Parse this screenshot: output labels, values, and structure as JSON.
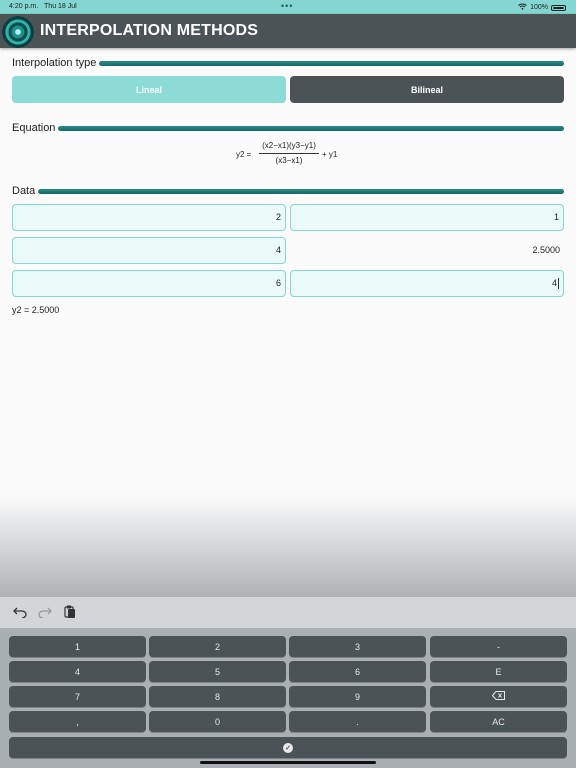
{
  "status": {
    "time": "4:20 p.m.",
    "date": "Thu 18 Jul",
    "dots": "•••",
    "wifi": "wifi-icon",
    "battery": "100%"
  },
  "header": {
    "title": "INTERPOLATION METHODS"
  },
  "type_section": {
    "label": "Interpolation type",
    "options": [
      "Lineal",
      "Bilineal"
    ],
    "selected": "Lineal"
  },
  "equation_section": {
    "label": "Equation",
    "lhs": "y2 =",
    "numerator": "(x2−x1)(y3−y1)",
    "denominator": "(x3−x1)",
    "rhs": "+ y1"
  },
  "data_section": {
    "label": "Data",
    "x1": "2",
    "y1": "1",
    "x2": "4",
    "y2": "2.5000",
    "x3": "6",
    "y3": "4"
  },
  "result": "y2 = 2.5000",
  "keyboard": {
    "rows": [
      [
        "1",
        "2",
        "3",
        "-"
      ],
      [
        "4",
        "5",
        "6",
        "E"
      ],
      [
        "7",
        "8",
        "9",
        "⌫"
      ],
      [
        ",",
        "0",
        ".",
        "AC"
      ]
    ],
    "done_icon": "checkmark-icon"
  },
  "colors": {
    "accent": "#84d6d3",
    "dark": "#4b5357",
    "teal_bar": "#1f7d78",
    "input_bg": "#e9faf9"
  }
}
